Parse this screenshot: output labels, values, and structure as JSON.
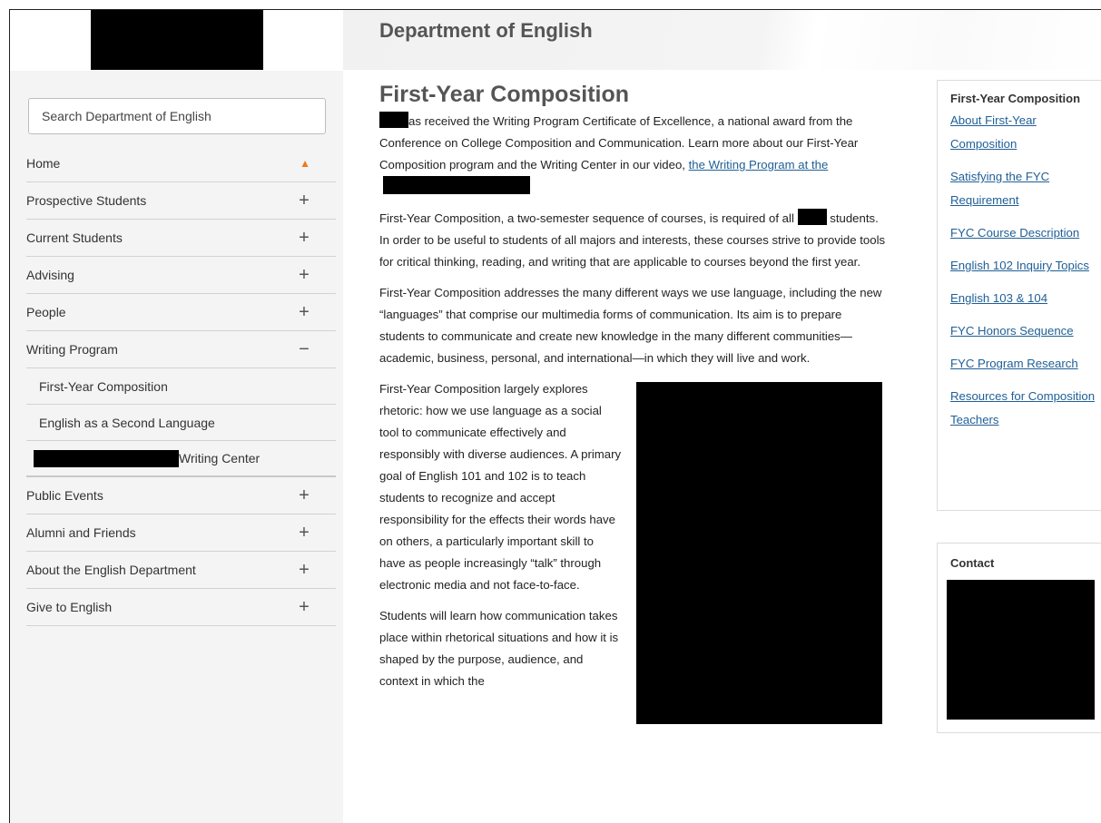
{
  "header": {
    "department_title": "Department of English"
  },
  "sidebar": {
    "search_placeholder": "Search Department of English",
    "items": [
      {
        "label": "Home",
        "toggle": "home"
      },
      {
        "label": "Prospective Students",
        "toggle": "+"
      },
      {
        "label": "Current Students",
        "toggle": "+"
      },
      {
        "label": "Advising",
        "toggle": "+"
      },
      {
        "label": "People",
        "toggle": "+"
      },
      {
        "label": "Writing Program",
        "toggle": "−"
      }
    ],
    "sub_items": [
      {
        "label": "First-Year Composition"
      },
      {
        "label": "English as a Second Language"
      },
      {
        "label": "Writing Center"
      }
    ],
    "items_after": [
      {
        "label": "Public Events",
        "toggle": "+"
      },
      {
        "label": "Alumni and Friends",
        "toggle": "+"
      },
      {
        "label": "About the English Department",
        "toggle": "+"
      },
      {
        "label": "Give to English",
        "toggle": "+"
      }
    ],
    "accent_color": "#ee7a1e"
  },
  "main": {
    "title": "First-Year Composition",
    "p1_text": "as received the Writing Program Certificate of Excellence, a national award from the Conference on College Composition and Communication. Learn more about our First-Year Composition program and the Writing Center in our video, ",
    "p1_link": "the Writing Program at the",
    "p2_start": "First-Year Composition, a two-semester sequence of courses, is required of all",
    "p2_end": "students. In order to be useful to students of all majors and interests, these courses strive to provide tools for critical thinking, reading, and writing that are applicable to courses beyond the first year.",
    "p3": "First-Year Composition addresses the many different ways we use language, including the new “languages” that comprise our multimedia forms of communication. Its aim is to prepare students to communicate and create new knowledge in the many different communities—academic, business, personal, and international—in which they will live and work.",
    "p4": "First-Year Composition largely explores rhetoric: how we use language as a social tool to communicate effectively and responsibly with diverse audiences. A primary goal of English 101 and 102 is to teach students to recognize and accept responsibility for the effects their words have on others, a particularly important skill to have as people increasingly “talk” through electronic media and not face-to-face.",
    "p5": "Students will learn how communication takes place within rhetorical situations and how it is shaped by the purpose, audience, and context in which the",
    "link_color": "#1f5f96"
  },
  "right_nav": {
    "title": "First-Year Composition",
    "links": [
      "About First-Year Composition",
      "Satisfying the FYC Requirement",
      "FYC Course Description",
      "English 102 Inquiry Topics",
      "English 103 & 104",
      "FYC Honors Sequence",
      "FYC Program Research",
      "Resources for Composition Teachers"
    ]
  },
  "contact": {
    "title": "Contact"
  }
}
